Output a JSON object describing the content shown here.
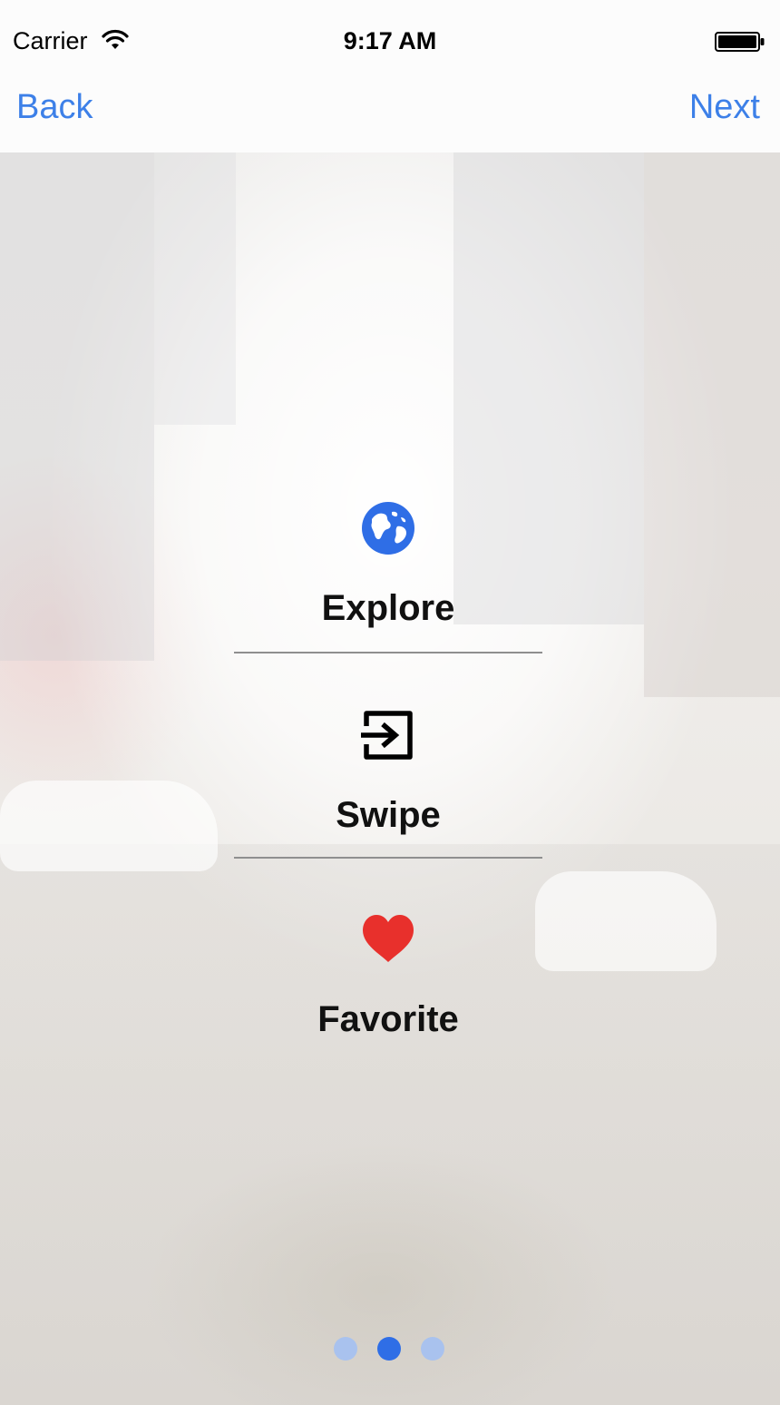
{
  "status_bar": {
    "carrier": "Carrier",
    "time": "9:17 AM",
    "wifi_icon": "wifi-icon",
    "battery_icon": "battery-icon"
  },
  "nav_bar": {
    "back_label": "Back",
    "next_label": "Next"
  },
  "features": [
    {
      "label": "Explore",
      "icon": "globe-icon",
      "icon_color": "#2f6ee6"
    },
    {
      "label": "Swipe",
      "icon": "exit-arrow-icon",
      "icon_color": "#000000"
    },
    {
      "label": "Favorite",
      "icon": "heart-icon",
      "icon_color": "#e8302c"
    }
  ],
  "page_control": {
    "page_count": 3,
    "current_page": 2,
    "active_color": "#2f6ee6",
    "inactive_color": "#a9c2ee"
  },
  "colors": {
    "accent": "#3d80e8"
  }
}
